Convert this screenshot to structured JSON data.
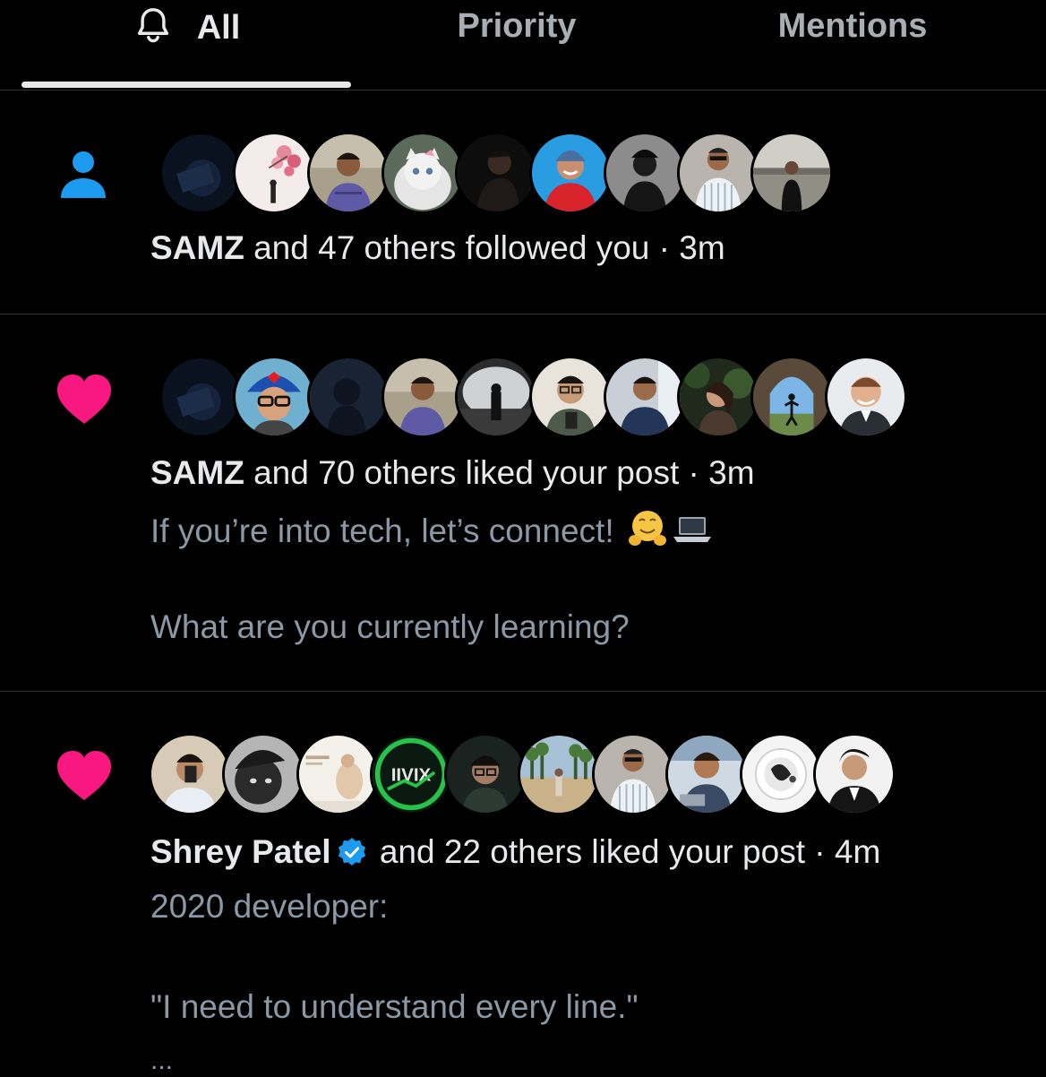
{
  "tabs": {
    "all": "All",
    "priority": "Priority",
    "mentions": "Mentions",
    "active": "All"
  },
  "icons": {
    "tab_all": "bell-icon",
    "follow": "person-icon",
    "like": "heart-icon",
    "verified": "verified-badge-icon"
  },
  "colors": {
    "background": "#000000",
    "text_primary": "#e7e9ea",
    "text_secondary": "#8b98a5",
    "follow_icon": "#1d9bf0",
    "like_icon": "#f91880",
    "verified": "#1d9bf0",
    "divider": "#2f3336"
  },
  "notifications": [
    {
      "type": "follow",
      "actor": "SAMZ",
      "action": " and 47 others followed you",
      "time": " · 3m",
      "avatar_count": 9
    },
    {
      "type": "like",
      "actor": "SAMZ",
      "action": " and 70 others liked your post",
      "time": " · 3m",
      "post_line_1": "If you’re into tech, let’s connect!",
      "post_emojis": [
        "hugging-face-emoji",
        "laptop-emoji"
      ],
      "post_line_2": "What are you currently learning?",
      "avatar_count": 10
    },
    {
      "type": "like",
      "actor": "Shrey Patel",
      "verified": true,
      "action": " and 22 others liked your post",
      "time": " · 4m",
      "post_line_1": "2020 developer:",
      "post_line_2": "\"I need to understand every line.\"",
      "post_ellipsis": "...",
      "avatar_count": 10
    }
  ]
}
